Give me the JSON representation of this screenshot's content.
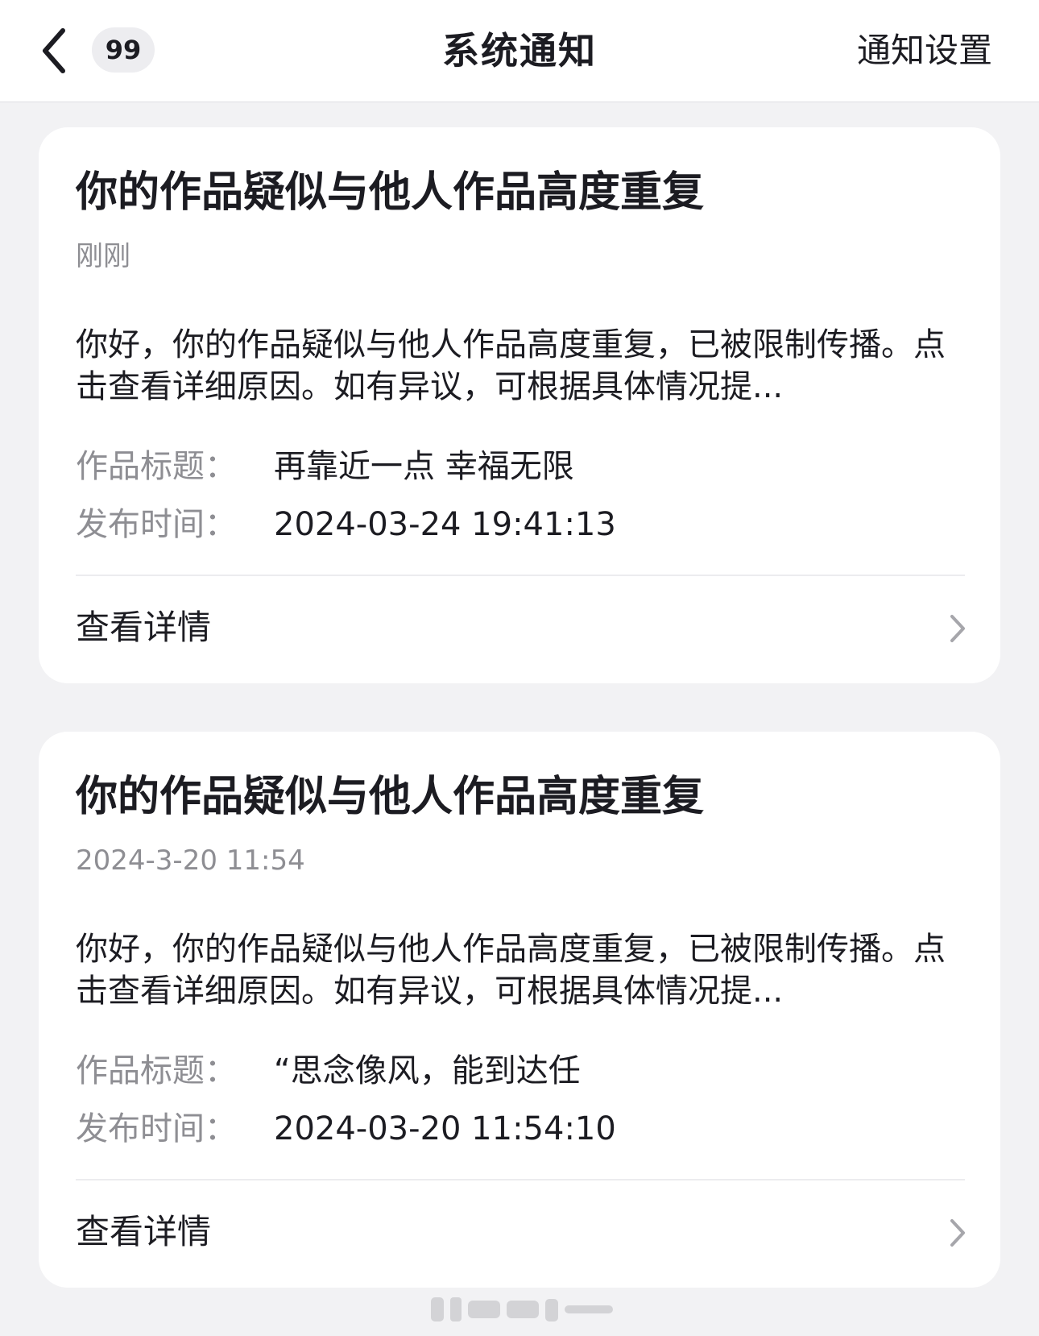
{
  "navbar": {
    "back_icon": "chevron-left-icon",
    "unread_count": "99",
    "title": "系统通知",
    "settings_label": "通知设置"
  },
  "notifications": [
    {
      "title": "你的作品疑似与他人作品高度重复",
      "time": "刚刚",
      "body": "你好，你的作品疑似与他人作品高度重复，已被限制传播。点击查看详细原因。如有异议，可根据具体情况提...",
      "work_title_label": "作品标题：",
      "work_title": "再靠近一点 幸福无限",
      "publish_time_label": "发布时间：",
      "publish_time": "2024-03-24 19:41:13",
      "detail_label": "查看详情"
    },
    {
      "title": "你的作品疑似与他人作品高度重复",
      "time": "2024-3-20 11:54",
      "body": "你好，你的作品疑似与他人作品高度重复，已被限制传播。点击查看详细原因。如有异议，可根据具体情况提...",
      "work_title_label": "作品标题：",
      "work_title": "“思念像风，能到达任",
      "publish_time_label": "发布时间：",
      "publish_time": "2024-03-20 11:54:10",
      "detail_label": "查看详情"
    }
  ],
  "colors": {
    "page_background": "#f2f2f4",
    "card_background": "#ffffff",
    "primary_text": "#1c1c22",
    "secondary_text": "#8e8e93",
    "badge_background": "#ededf0"
  }
}
